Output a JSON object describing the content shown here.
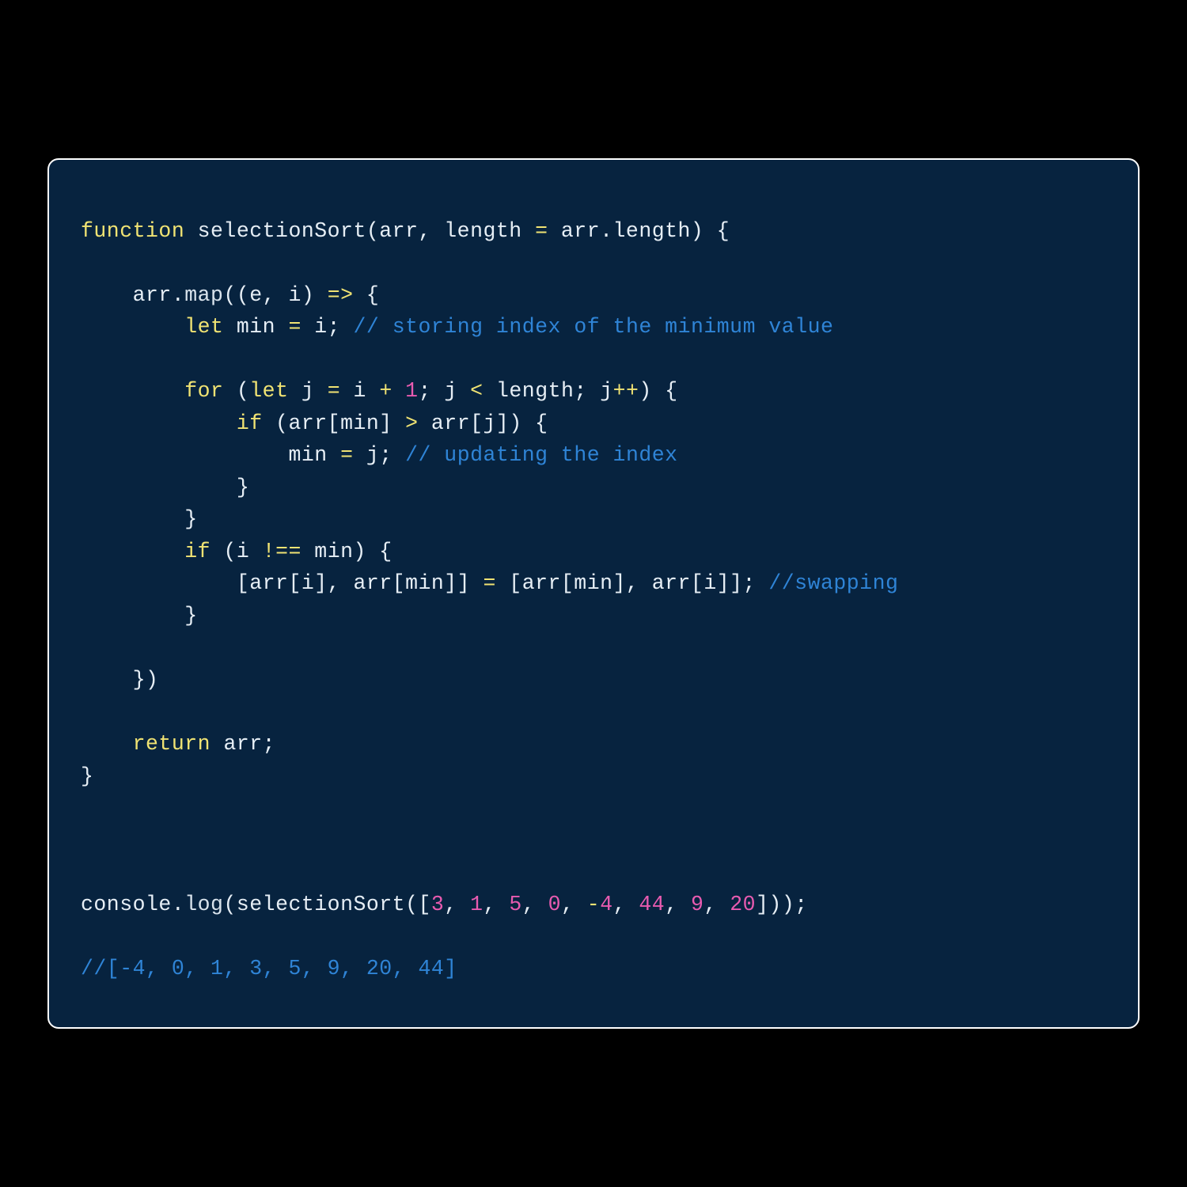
{
  "colors": {
    "page_bg": "#000000",
    "card_bg": "#07233f",
    "card_border": "#ffffff",
    "keyword": "#f0e373",
    "comment": "#2f84d6",
    "number": "#e85bb0",
    "default": "#e6eef5"
  },
  "code": {
    "function_name": "selectionSort",
    "input_array": [
      3,
      1,
      5,
      0,
      -4,
      44,
      9,
      20
    ],
    "output_array": [
      -4,
      0,
      1,
      3,
      5,
      9,
      20,
      44
    ],
    "lines": [
      [
        {
          "t": "function ",
          "c": "keyword"
        },
        {
          "t": "selectionSort(arr, length ",
          "c": "default"
        },
        {
          "t": "=",
          "c": "keyword"
        },
        {
          "t": " arr.length) {",
          "c": "default"
        }
      ],
      [
        {
          "t": "",
          "c": "default"
        }
      ],
      [
        {
          "t": "    arr.",
          "c": "default"
        },
        {
          "t": "map",
          "c": "ident"
        },
        {
          "t": "((e, i) ",
          "c": "default"
        },
        {
          "t": "=>",
          "c": "keyword"
        },
        {
          "t": " {",
          "c": "default"
        }
      ],
      [
        {
          "t": "        ",
          "c": "default"
        },
        {
          "t": "let",
          "c": "keyword"
        },
        {
          "t": " min ",
          "c": "default"
        },
        {
          "t": "=",
          "c": "keyword"
        },
        {
          "t": " i; ",
          "c": "default"
        },
        {
          "t": "// storing index of the minimum value",
          "c": "comment"
        }
      ],
      [
        {
          "t": "",
          "c": "default"
        }
      ],
      [
        {
          "t": "        ",
          "c": "default"
        },
        {
          "t": "for",
          "c": "keyword"
        },
        {
          "t": " (",
          "c": "default"
        },
        {
          "t": "let",
          "c": "keyword"
        },
        {
          "t": " j ",
          "c": "default"
        },
        {
          "t": "=",
          "c": "keyword"
        },
        {
          "t": " i ",
          "c": "default"
        },
        {
          "t": "+",
          "c": "keyword"
        },
        {
          "t": " ",
          "c": "default"
        },
        {
          "t": "1",
          "c": "number"
        },
        {
          "t": "; j ",
          "c": "default"
        },
        {
          "t": "<",
          "c": "keyword"
        },
        {
          "t": " length; j",
          "c": "default"
        },
        {
          "t": "++",
          "c": "keyword"
        },
        {
          "t": ") {",
          "c": "default"
        }
      ],
      [
        {
          "t": "            ",
          "c": "default"
        },
        {
          "t": "if",
          "c": "keyword"
        },
        {
          "t": " (arr[min] ",
          "c": "default"
        },
        {
          "t": ">",
          "c": "keyword"
        },
        {
          "t": " arr[j]) {",
          "c": "default"
        }
      ],
      [
        {
          "t": "                min ",
          "c": "default"
        },
        {
          "t": "=",
          "c": "keyword"
        },
        {
          "t": " j; ",
          "c": "default"
        },
        {
          "t": "// updating the index",
          "c": "comment"
        }
      ],
      [
        {
          "t": "            }",
          "c": "default"
        }
      ],
      [
        {
          "t": "        }",
          "c": "default"
        }
      ],
      [
        {
          "t": "        ",
          "c": "default"
        },
        {
          "t": "if",
          "c": "keyword"
        },
        {
          "t": " (i ",
          "c": "default"
        },
        {
          "t": "!==",
          "c": "keyword"
        },
        {
          "t": " min) {",
          "c": "default"
        }
      ],
      [
        {
          "t": "            [arr[i], arr[min]] ",
          "c": "default"
        },
        {
          "t": "=",
          "c": "keyword"
        },
        {
          "t": " [arr[min], arr[i]]; ",
          "c": "default"
        },
        {
          "t": "//swapping",
          "c": "comment"
        }
      ],
      [
        {
          "t": "        }",
          "c": "default"
        }
      ],
      [
        {
          "t": "",
          "c": "default"
        }
      ],
      [
        {
          "t": "    })",
          "c": "default"
        }
      ],
      [
        {
          "t": "",
          "c": "default"
        }
      ],
      [
        {
          "t": "    ",
          "c": "default"
        },
        {
          "t": "return",
          "c": "keyword"
        },
        {
          "t": " arr;",
          "c": "default"
        }
      ],
      [
        {
          "t": "}",
          "c": "default"
        }
      ],
      [
        {
          "t": "",
          "c": "default"
        }
      ],
      [
        {
          "t": "",
          "c": "default"
        }
      ],
      [
        {
          "t": "",
          "c": "default"
        }
      ],
      [
        {
          "t": "console.",
          "c": "default"
        },
        {
          "t": "log",
          "c": "ident"
        },
        {
          "t": "(selectionSort([",
          "c": "default"
        },
        {
          "t": "3",
          "c": "number"
        },
        {
          "t": ", ",
          "c": "default"
        },
        {
          "t": "1",
          "c": "number"
        },
        {
          "t": ", ",
          "c": "default"
        },
        {
          "t": "5",
          "c": "number"
        },
        {
          "t": ", ",
          "c": "default"
        },
        {
          "t": "0",
          "c": "number"
        },
        {
          "t": ", ",
          "c": "default"
        },
        {
          "t": "-",
          "c": "keyword"
        },
        {
          "t": "4",
          "c": "number"
        },
        {
          "t": ", ",
          "c": "default"
        },
        {
          "t": "44",
          "c": "number"
        },
        {
          "t": ", ",
          "c": "default"
        },
        {
          "t": "9",
          "c": "number"
        },
        {
          "t": ", ",
          "c": "default"
        },
        {
          "t": "20",
          "c": "number"
        },
        {
          "t": "]));",
          "c": "default"
        }
      ],
      [
        {
          "t": "",
          "c": "default"
        }
      ],
      [
        {
          "t": "//[-4, 0, 1, 3, 5, 9, 20, 44]",
          "c": "comment"
        }
      ]
    ]
  }
}
